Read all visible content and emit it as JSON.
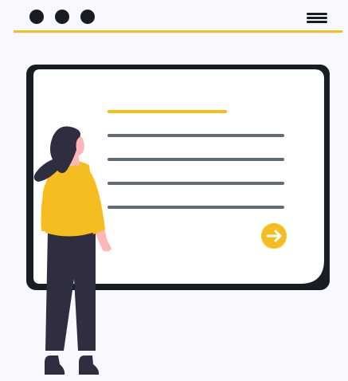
{
  "icons": {
    "window_dots": "three-dots-icon",
    "menu": "hamburger-menu-icon",
    "next": "arrow-right-icon"
  },
  "colors": {
    "background": "#f8f8fe",
    "accent": "#f5bd1f",
    "dark": "#181d24",
    "text_line": "#636b78",
    "figure_dark": "#2f2e41",
    "skin": "#ffb6b6",
    "screen": "#ffffff"
  }
}
